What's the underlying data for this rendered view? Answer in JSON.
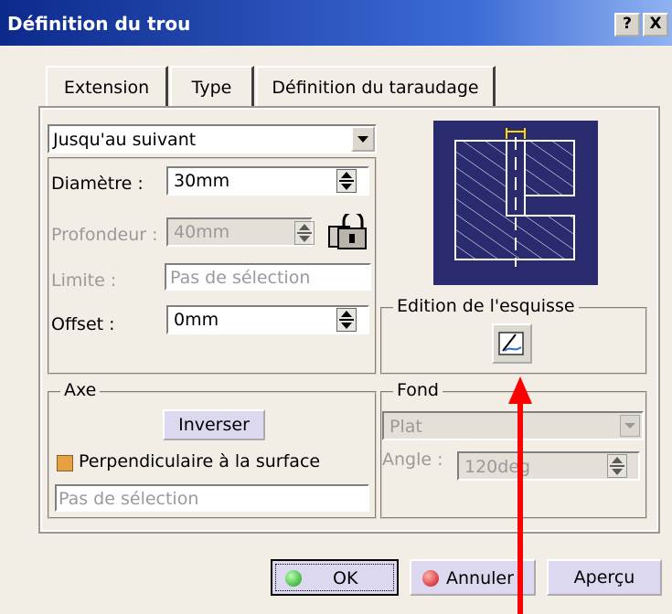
{
  "window": {
    "title": "Définition du trou",
    "help_glyph": "?",
    "close_glyph": "X"
  },
  "tabs": [
    "Extension",
    "Type",
    "Définition du taraudage"
  ],
  "extension": {
    "mode_value": "Jusqu'au suivant",
    "diameter_label": "Diamètre :",
    "diameter_value": "30mm",
    "depth_label": "Profondeur :",
    "depth_value": "40mm",
    "limit_label": "Limite :",
    "limit_value": "Pas de sélection",
    "offset_label": "Offset :",
    "offset_value": "0mm"
  },
  "sketch_group": {
    "title": "Edition de l'esquisse"
  },
  "axis_group": {
    "title": "Axe",
    "invert_label": "Inverser",
    "perpendicular_label": "Perpendiculaire à la surface",
    "selection_value": "Pas de sélection"
  },
  "bottom_group": {
    "title": "Fond",
    "type_value": "Plat",
    "angle_label": "Angle :",
    "angle_value": "120deg"
  },
  "buttons": {
    "ok": "OK",
    "cancel": "Annuler",
    "preview": "Aperçu"
  },
  "colors": {
    "title_bar": "#0c2a8c",
    "preview_bg": "#2a2a6e",
    "arrow": "#ff0000"
  }
}
